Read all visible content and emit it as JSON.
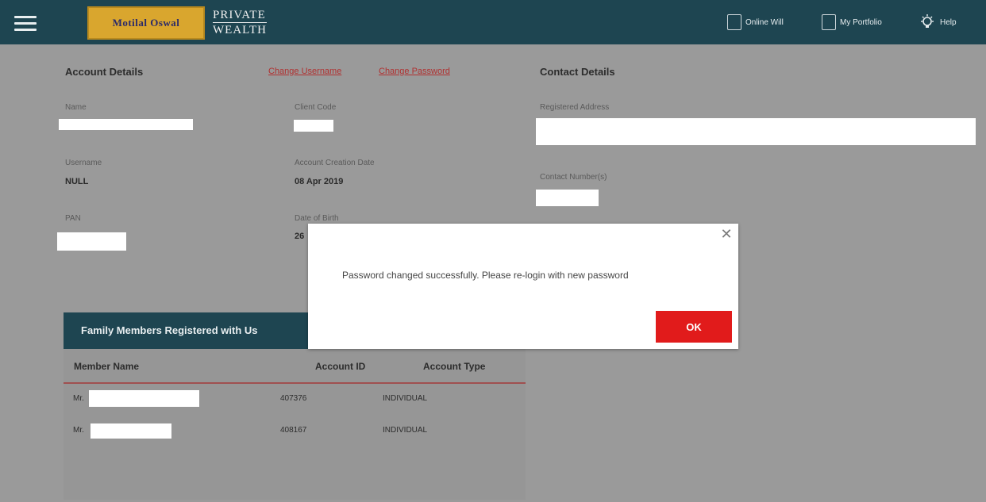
{
  "header": {
    "logo_text": "Motilal Oswal",
    "brand_line1": "PRIVATE",
    "brand_line2": "WEALTH",
    "nav": [
      {
        "label": "Online Will",
        "icon": "document-icon"
      },
      {
        "label": "My Portfolio",
        "icon": "portfolio-icon"
      },
      {
        "label": "Help",
        "icon": "lightbulb-icon"
      }
    ]
  },
  "account": {
    "heading": "Account Details",
    "change_username": "Change Username",
    "change_password": "Change Password",
    "name_label": "Name",
    "client_code_label": "Client Code",
    "username_label": "Username",
    "username_value": "NULL",
    "creation_label": "Account Creation Date",
    "creation_value": "08 Apr 2019",
    "pan_label": "PAN",
    "dob_label": "Date of Birth",
    "dob_value_partial": "26"
  },
  "contact": {
    "heading": "Contact Details",
    "address_label": "Registered Address",
    "number_label": "Contact Number(s)"
  },
  "family": {
    "title": "Family Members Registered with Us",
    "columns": [
      "Member Name",
      "Account ID",
      "Account Type"
    ],
    "rows": [
      {
        "name_prefix": "Mr.",
        "account_id": "407376",
        "account_type": "INDIVIDUAL"
      },
      {
        "name_prefix": "Mr.",
        "account_id": "408167",
        "account_type": "INDIVIDUAL"
      }
    ]
  },
  "dialog": {
    "message": "Password changed successfully. Please re-login with new password",
    "ok_label": "OK",
    "close_symbol": "✕"
  },
  "colors": {
    "header_bg": "#1e4551",
    "overlay_gray": "#9a9a9a",
    "ok_red": "#e11b1b",
    "link_red": "#b03030"
  }
}
